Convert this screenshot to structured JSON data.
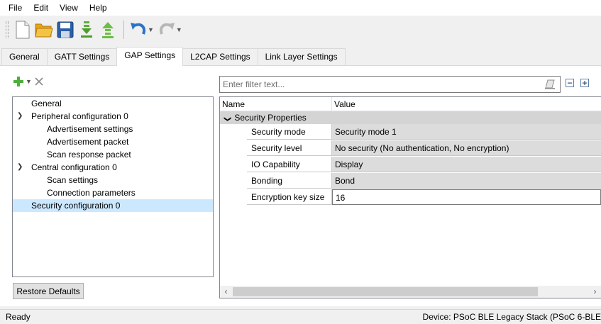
{
  "menu": [
    "File",
    "Edit",
    "View",
    "Help"
  ],
  "toolbar": {
    "icons": [
      "new-file-icon",
      "open-folder-icon",
      "save-icon",
      "import-icon",
      "export-icon",
      "undo-icon",
      "redo-icon"
    ]
  },
  "tabs": [
    "General",
    "GATT Settings",
    "GAP Settings",
    "L2CAP Settings",
    "Link Layer Settings"
  ],
  "active_tab": "GAP Settings",
  "tree": {
    "items": [
      {
        "label": "General",
        "level": 0
      },
      {
        "label": "Peripheral configuration 0",
        "level": 0
      },
      {
        "label": "Advertisement settings",
        "level": 1
      },
      {
        "label": "Advertisement packet",
        "level": 1
      },
      {
        "label": "Scan response packet",
        "level": 1
      },
      {
        "label": "Central configuration 0",
        "level": 0
      },
      {
        "label": "Scan settings",
        "level": 1
      },
      {
        "label": "Connection parameters",
        "level": 1
      },
      {
        "label": "Security configuration 0",
        "level": 0
      }
    ],
    "selected": "Security configuration 0"
  },
  "restore_defaults": "Restore Defaults",
  "filter": {
    "placeholder": "Enter filter text..."
  },
  "grid": {
    "header_name": "Name",
    "header_value": "Value",
    "group": "Security Properties",
    "rows": [
      {
        "name": "Security mode",
        "value": "Security mode 1"
      },
      {
        "name": "Security level",
        "value": "No security (No authentication, No encryption)"
      },
      {
        "name": "IO Capability",
        "value": "Display"
      },
      {
        "name": "Bonding",
        "value": "Bond"
      },
      {
        "name": "Encryption key size",
        "value": "16"
      }
    ]
  },
  "status": {
    "left": "Ready",
    "right": "Device: PSoC BLE Legacy Stack (PSoC 6-BLE"
  }
}
